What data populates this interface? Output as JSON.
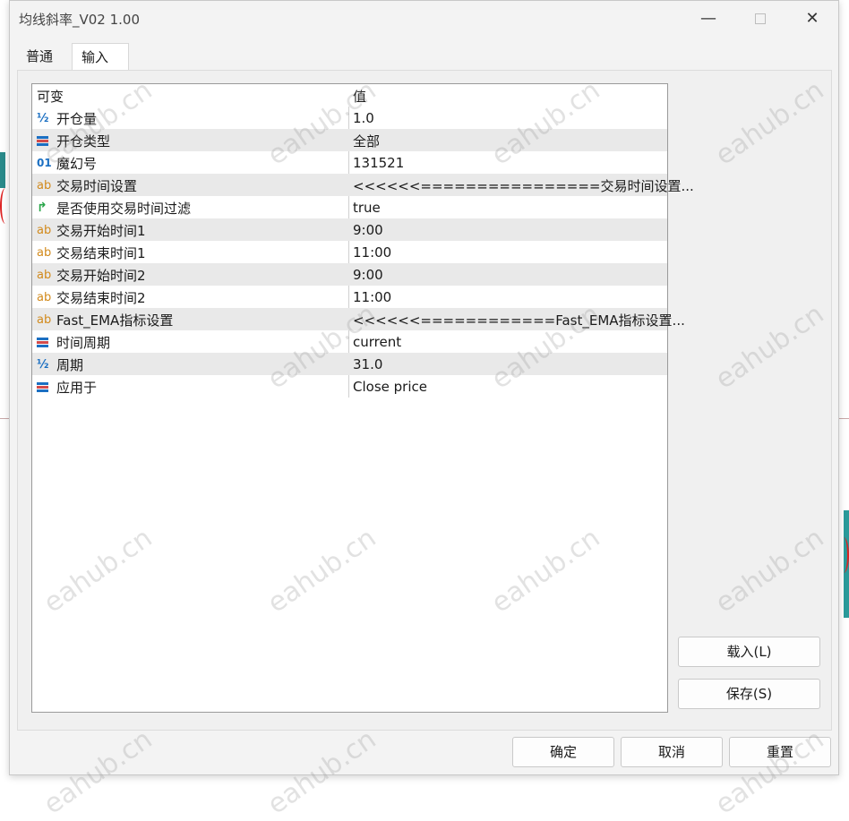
{
  "window": {
    "title": "均线斜率_V02 1.00",
    "minimize": "—",
    "close": "✕"
  },
  "tabs": [
    {
      "label": "普通"
    },
    {
      "label": "输入"
    }
  ],
  "grid": {
    "headers": {
      "name": "可变",
      "value": "值"
    },
    "rows": [
      {
        "icon": "½",
        "name": "开仓量",
        "value": "1.0"
      },
      {
        "icon": "enum",
        "name": "开仓类型",
        "value": "全部"
      },
      {
        "icon": "01",
        "name": "魔幻号",
        "value": "131521"
      },
      {
        "icon": "ab",
        "name": "交易时间设置",
        "value": "<<<<<<================交易时间设置..."
      },
      {
        "icon": "bool",
        "name": "是否使用交易时间过滤",
        "value": "true"
      },
      {
        "icon": "ab",
        "name": "交易开始时间1",
        "value": "9:00"
      },
      {
        "icon": "ab",
        "name": "交易结束时间1",
        "value": "11:00"
      },
      {
        "icon": "ab",
        "name": "交易开始时间2",
        "value": "9:00"
      },
      {
        "icon": "ab",
        "name": "交易结束时间2",
        "value": "11:00"
      },
      {
        "icon": "ab",
        "name": "Fast_EMA指标设置",
        "value": "<<<<<<============Fast_EMA指标设置..."
      },
      {
        "icon": "enum",
        "name": "时间周期",
        "value": "current"
      },
      {
        "icon": "½",
        "name": "周期",
        "value": "31.0"
      },
      {
        "icon": "enum",
        "name": "应用于",
        "value": "Close price"
      }
    ]
  },
  "buttons": {
    "load": "载入(L)",
    "save": "保存(S)",
    "ok": "确定",
    "cancel": "取消",
    "reset": "重置"
  },
  "watermark": "eahub.cn"
}
